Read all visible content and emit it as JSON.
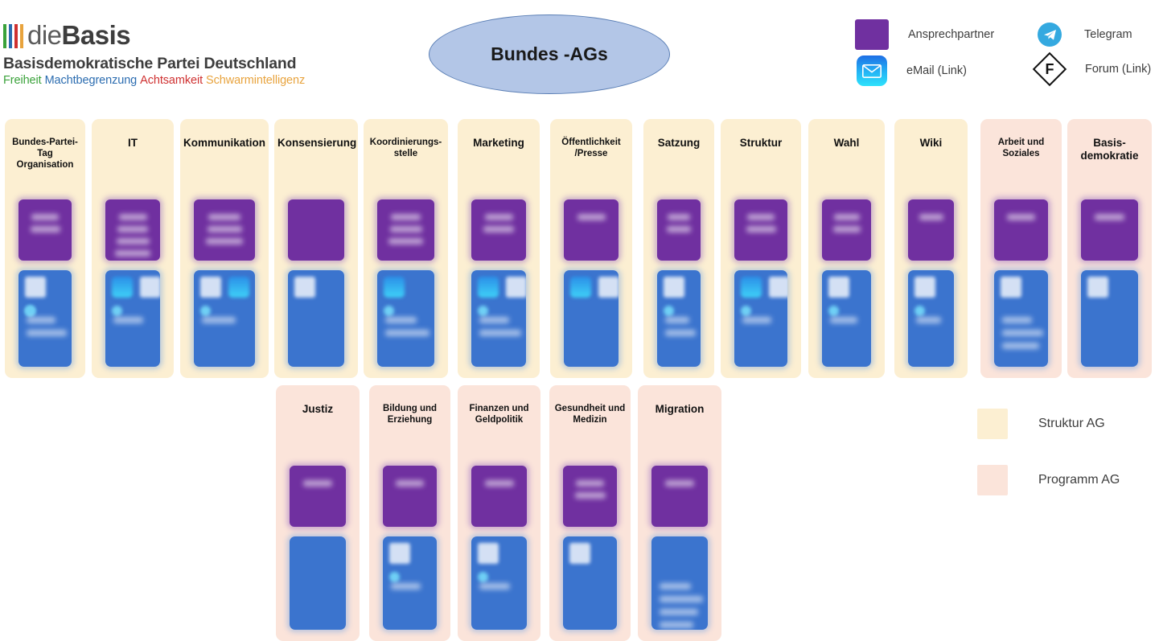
{
  "logo": {
    "bars": [
      "#3aa23a",
      "#2b6cb0",
      "#cf3030",
      "#e8a33d"
    ],
    "word_die": "die",
    "word_basis": "Basis",
    "subtitle": "Basisdemokratische Partei Deutschland",
    "values": [
      {
        "text": "Freiheit",
        "color": "#3aa23a"
      },
      {
        "text": "Machtbegrenzung",
        "color": "#2b6cb0"
      },
      {
        "text": "Achtsamkeit",
        "color": "#cf3030"
      },
      {
        "text": "Schwarmintelligenz",
        "color": "#e8a33d"
      }
    ]
  },
  "title": {
    "text": "Bundes -AGs"
  },
  "legend_top": [
    {
      "label": "Ansprechpartner",
      "icon": "purple-swatch"
    },
    {
      "label": "eMail (Link)",
      "icon": "mail-icon"
    },
    {
      "label": "Telegram",
      "icon": "telegram-icon"
    },
    {
      "label": "Forum (Link)",
      "icon": "forum-icon"
    }
  ],
  "legend_bottom": [
    {
      "label": "Struktur AG",
      "color": "#FCEFD2"
    },
    {
      "label": "Programm AG",
      "color": "#FBE4DA"
    }
  ],
  "colors": {
    "struktur_ag": "#FCEFD2",
    "programm_ag": "#FBE4DA",
    "ansprechpartner": "#7030A0",
    "kontakt": "#3B74CE",
    "title_ellipse": "#b3c6e7"
  },
  "row1": [
    {
      "title": "Bundes-Partei-Tag Organisation",
      "type": "struktur",
      "contact_lines": 2,
      "icons": [
        "forum-icon",
        "telegram-icon",
        "telegram-icon"
      ],
      "link_lines": 2
    },
    {
      "title": "IT",
      "type": "struktur",
      "contact_lines": 4,
      "icons": [
        "mail-icon",
        "forum-icon",
        "telegram-icon"
      ],
      "link_lines": 1
    },
    {
      "title": "Kommunikation",
      "type": "struktur",
      "contact_lines": 3,
      "icons": [
        "forum-icon",
        "mail-icon",
        "telegram-icon"
      ],
      "link_lines": 1
    },
    {
      "title": "Konsensierung",
      "type": "struktur",
      "contact_lines": 0,
      "icons": [
        "forum-icon"
      ],
      "link_lines": 0
    },
    {
      "title": "Koordinierungs-stelle",
      "type": "struktur",
      "contact_lines": 3,
      "icons": [
        "mail-icon",
        "telegram-icon"
      ],
      "link_lines": 2
    },
    {
      "title": "Marketing",
      "type": "struktur",
      "contact_lines": 2,
      "icons": [
        "mail-icon",
        "forum-icon",
        "telegram-icon"
      ],
      "link_lines": 2
    },
    {
      "title": "Öffentlichkeit /Presse",
      "type": "struktur",
      "contact_lines": 1,
      "icons": [
        "mail-icon",
        "forum-icon"
      ],
      "link_lines": 0
    },
    {
      "title": "Satzung",
      "type": "struktur",
      "contact_lines": 2,
      "icons": [
        "forum-icon",
        "telegram-icon"
      ],
      "link_lines": 2
    },
    {
      "title": "Struktur",
      "type": "struktur",
      "contact_lines": 2,
      "icons": [
        "mail-icon",
        "forum-icon",
        "telegram-icon"
      ],
      "link_lines": 1
    },
    {
      "title": "Wahl",
      "type": "struktur",
      "contact_lines": 2,
      "icons": [
        "forum-icon",
        "telegram-icon"
      ],
      "link_lines": 1
    },
    {
      "title": "Wiki",
      "type": "struktur",
      "contact_lines": 1,
      "icons": [
        "forum-icon",
        "telegram-icon"
      ],
      "link_lines": 1
    },
    {
      "title": "Arbeit und Soziales",
      "type": "programm",
      "contact_lines": 1,
      "icons": [
        "forum-icon"
      ],
      "link_lines": 3
    },
    {
      "title": "Basis-demokratie",
      "type": "programm",
      "contact_lines": 1,
      "icons": [
        "forum-icon"
      ],
      "link_lines": 0
    }
  ],
  "row2": [
    {
      "title": "Justiz",
      "type": "programm",
      "contact_lines": 1,
      "icons": [],
      "link_lines": 0
    },
    {
      "title": "Bildung und Erziehung",
      "type": "programm",
      "contact_lines": 1,
      "icons": [
        "forum-icon",
        "telegram-icon"
      ],
      "link_lines": 1
    },
    {
      "title": "Finanzen und Geldpolitik",
      "type": "programm",
      "contact_lines": 1,
      "icons": [
        "forum-icon",
        "telegram-icon"
      ],
      "link_lines": 1
    },
    {
      "title": "Gesundheit und Medizin",
      "type": "programm",
      "contact_lines": 2,
      "icons": [
        "forum-icon"
      ],
      "link_lines": 0
    },
    {
      "title": "Migration",
      "type": "programm",
      "contact_lines": 1,
      "icons": [],
      "link_lines": 4
    }
  ]
}
